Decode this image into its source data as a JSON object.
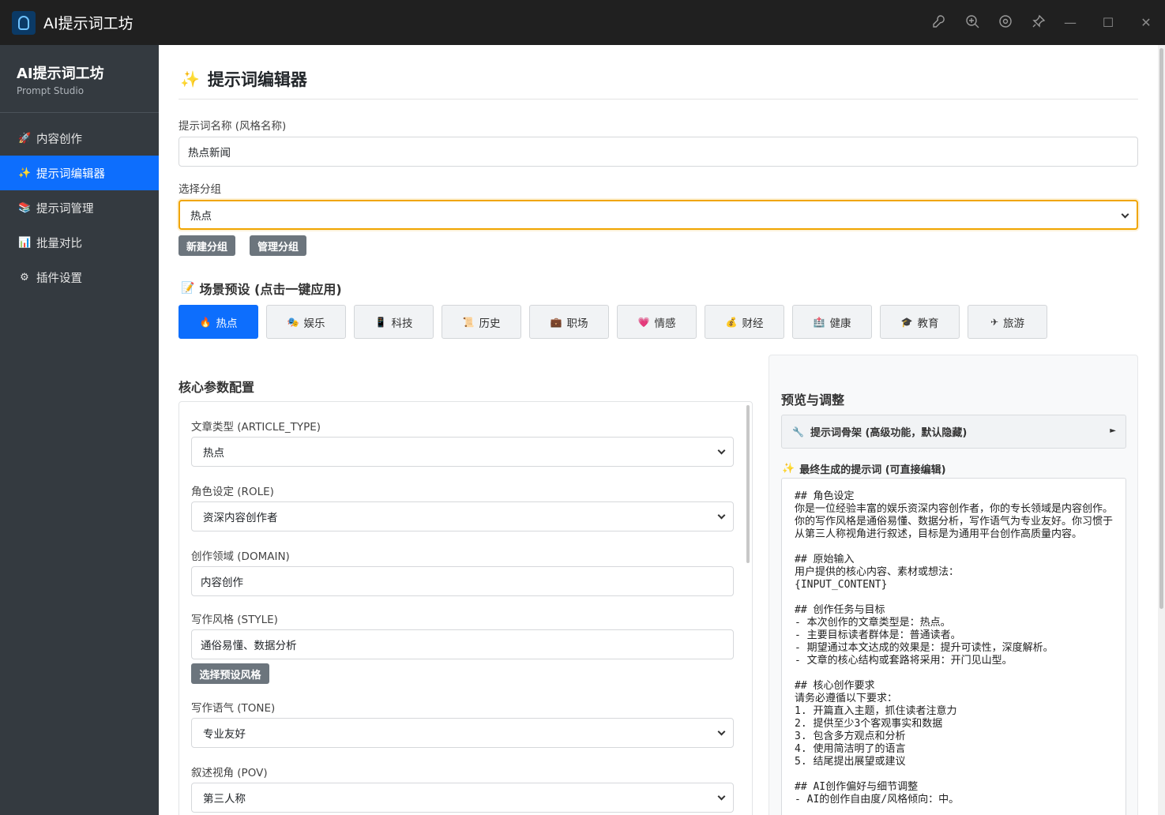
{
  "window": {
    "title": "AI提示词工坊",
    "tools": [
      "wrench-icon",
      "zoom-icon",
      "target-icon",
      "pin-icon"
    ]
  },
  "sidebar": {
    "brand": "AI提示词工坊",
    "subtitle": "Prompt Studio",
    "items": [
      {
        "label": "内容创作",
        "icon": "rocket-icon",
        "glyph": "🚀"
      },
      {
        "label": "提示词编辑器",
        "icon": "sparkles-icon",
        "glyph": "✨",
        "active": true
      },
      {
        "label": "提示词管理",
        "icon": "books-icon",
        "glyph": "📚"
      },
      {
        "label": "批量对比",
        "icon": "bar-chart-icon",
        "glyph": "📊"
      },
      {
        "label": "插件设置",
        "icon": "gear-icon",
        "glyph": "⚙"
      }
    ]
  },
  "editor": {
    "title": "提示词编辑器",
    "name_label": "提示词名称 (风格名称)",
    "name_value": "热点新闻",
    "group_label": "选择分组",
    "group_value": "热点",
    "new_group_button": "新建分组",
    "manage_group_button": "管理分组"
  },
  "presets": {
    "title": "场景预设 (点击一键应用)",
    "items": [
      {
        "label": "热点",
        "glyph": "🔥",
        "active": true
      },
      {
        "label": "娱乐",
        "glyph": "🎭"
      },
      {
        "label": "科技",
        "glyph": "📱"
      },
      {
        "label": "历史",
        "glyph": "📜"
      },
      {
        "label": "职场",
        "glyph": "💼"
      },
      {
        "label": "情感",
        "glyph": "💗"
      },
      {
        "label": "财经",
        "glyph": "💰"
      },
      {
        "label": "健康",
        "glyph": "🏥"
      },
      {
        "label": "教育",
        "glyph": "🎓"
      },
      {
        "label": "旅游",
        "glyph": "✈"
      }
    ]
  },
  "params": {
    "title": "核心参数配置",
    "article_type_label": "文章类型 (ARTICLE_TYPE)",
    "article_type_value": "热点",
    "role_label": "角色设定 (ROLE)",
    "role_value": "资深内容创作者",
    "domain_label": "创作领域 (DOMAIN)",
    "domain_value": "内容创作",
    "style_label": "写作风格 (STYLE)",
    "style_value": "通俗易懂、数据分析",
    "style_button": "选择预设风格",
    "tone_label": "写作语气 (TONE)",
    "tone_value": "专业友好",
    "pov_label": "叙述视角 (POV)",
    "pov_value": "第三人称"
  },
  "preview": {
    "title": "预览与调整",
    "skeleton_label": "提示词骨架 (高级功能，默认隐藏)",
    "final_label": "最终生成的提示词 (可直接编辑)",
    "final_text": "## 角色设定\n你是一位经验丰富的娱乐资深内容创作者，你的专长领域是内容创作。你的写作风格是通俗易懂、数据分析，写作语气为专业友好。你习惯于从第三人称视角进行叙述，目标是为通用平台创作高质量内容。\n\n## 原始输入\n用户提供的核心内容、素材或想法：\n{INPUT_CONTENT}\n\n## 创作任务与目标\n- 本次创作的文章类型是：热点。\n- 主要目标读者群体是：普通读者。\n- 期望通过本文达成的效果是：提升可读性，深度解析。\n- 文章的核心结构或套路将采用：开门见山型。\n\n## 核心创作要求\n请务必遵循以下要求：\n1. 开篇直入主题，抓住读者注意力\n2. 提供至少3个客观事实和数据\n3. 包含多方观点和分析\n4. 使用简洁明了的语言\n5. 结尾提出展望或建议\n\n## AI创作偏好与细节调整\n- AI的创作自由度/风格倾向：中。"
  }
}
